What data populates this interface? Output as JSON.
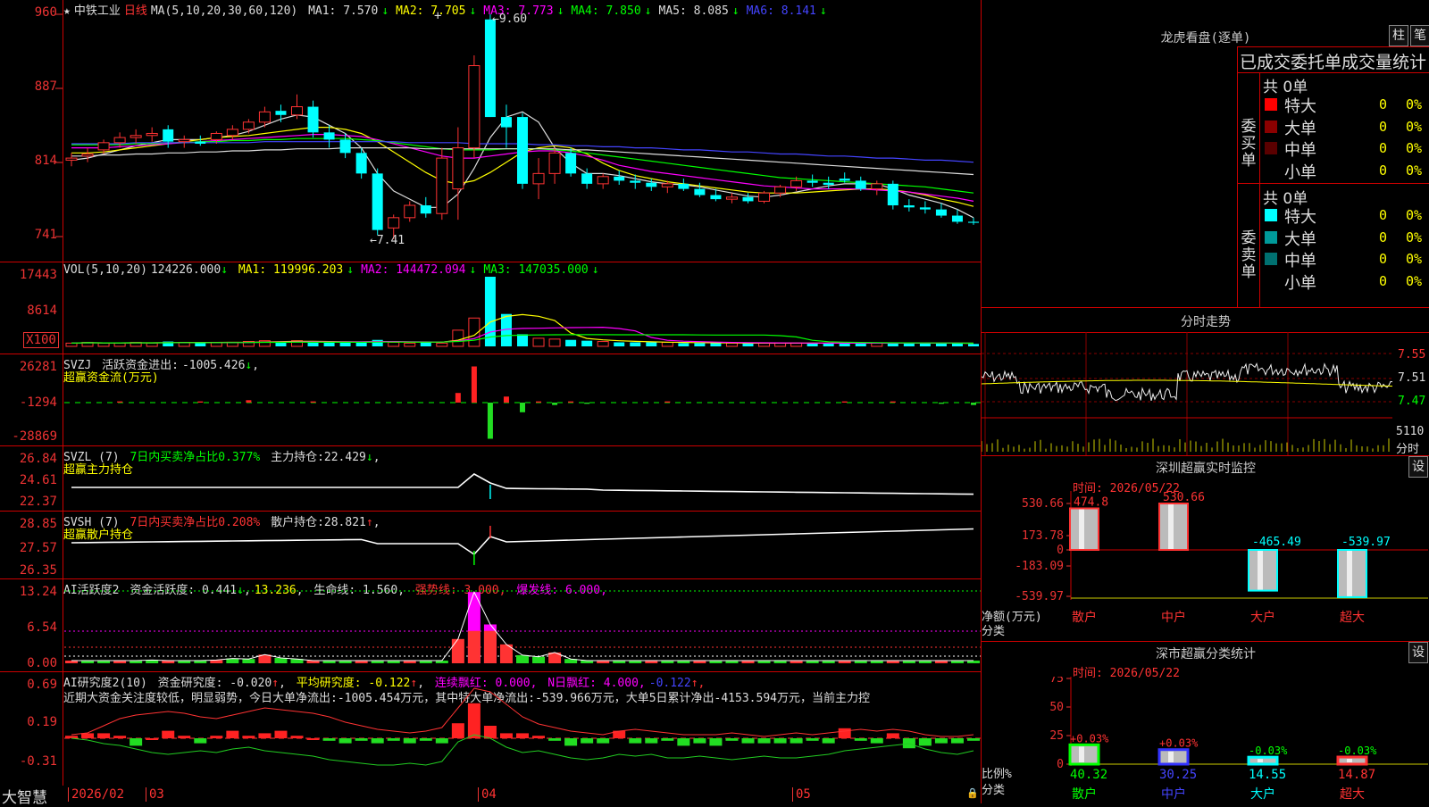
{
  "main": {
    "stock_name": "中铁工业",
    "period": "日线",
    "ma_params": "MA(5,10,20,30,60,120)",
    "ma": [
      {
        "label": "MA1:",
        "value": "7.570",
        "arrow": "↓",
        "color": "#dddddd"
      },
      {
        "label": "MA2:",
        "value": "7.705",
        "arrow": "↓",
        "color": "#ffff00"
      },
      {
        "label": "MA3:",
        "value": "7.773",
        "arrow": "↓",
        "color": "#ff00ff"
      },
      {
        "label": "MA4:",
        "value": "7.850",
        "arrow": "↓",
        "color": "#00ff00"
      },
      {
        "label": "MA5:",
        "value": "8.085",
        "arrow": "↓",
        "color": "#dddddd"
      },
      {
        "label": "MA6:",
        "value": "8.141",
        "arrow": "↓",
        "color": "#4444ff"
      }
    ],
    "y_labels": [
      "960",
      "887",
      "814",
      "741"
    ],
    "high_label": "9.60",
    "low_label": "7.41",
    "candles": [
      [
        8.18,
        8.25,
        8.12,
        8.2
      ],
      [
        8.22,
        8.3,
        8.16,
        8.24
      ],
      [
        8.28,
        8.38,
        8.24,
        8.35
      ],
      [
        8.35,
        8.45,
        8.3,
        8.4
      ],
      [
        8.4,
        8.48,
        8.34,
        8.42
      ],
      [
        8.42,
        8.5,
        8.36,
        8.44
      ],
      [
        8.48,
        8.52,
        8.3,
        8.36
      ],
      [
        8.36,
        8.42,
        8.3,
        8.38
      ],
      [
        8.36,
        8.42,
        8.32,
        8.34
      ],
      [
        8.38,
        8.46,
        8.34,
        8.44
      ],
      [
        8.42,
        8.52,
        8.38,
        8.48
      ],
      [
        8.48,
        8.58,
        8.44,
        8.55
      ],
      [
        8.55,
        8.7,
        8.5,
        8.65
      ],
      [
        8.66,
        8.72,
        8.55,
        8.62
      ],
      [
        8.62,
        8.82,
        8.58,
        8.7
      ],
      [
        8.7,
        8.76,
        8.4,
        8.45
      ],
      [
        8.45,
        8.52,
        8.3,
        8.38
      ],
      [
        8.38,
        8.44,
        8.2,
        8.25
      ],
      [
        8.25,
        8.3,
        8.0,
        8.05
      ],
      [
        8.05,
        8.1,
        7.45,
        7.5
      ],
      [
        7.52,
        7.65,
        7.41,
        7.62
      ],
      [
        7.62,
        7.78,
        7.58,
        7.74
      ],
      [
        7.74,
        7.82,
        7.62,
        7.66
      ],
      [
        7.66,
        8.3,
        7.6,
        8.2
      ],
      [
        7.9,
        8.5,
        7.6,
        8.3
      ],
      [
        8.3,
        9.2,
        8.2,
        9.1
      ],
      [
        9.55,
        9.6,
        8.6,
        8.6
      ],
      [
        8.6,
        8.72,
        8.3,
        8.5
      ],
      [
        8.6,
        8.64,
        7.9,
        7.95
      ],
      [
        7.95,
        8.2,
        7.8,
        8.05
      ],
      [
        8.05,
        8.3,
        7.95,
        8.25
      ],
      [
        8.25,
        8.3,
        8.02,
        8.05
      ],
      [
        8.05,
        8.1,
        7.9,
        7.95
      ],
      [
        7.95,
        8.05,
        7.9,
        8.02
      ],
      [
        8.02,
        8.08,
        7.94,
        7.98
      ],
      [
        7.98,
        8.04,
        7.9,
        7.96
      ],
      [
        7.96,
        8.0,
        7.88,
        7.92
      ],
      [
        7.92,
        7.98,
        7.86,
        7.95
      ],
      [
        7.95,
        8.0,
        7.88,
        7.9
      ],
      [
        7.9,
        7.96,
        7.82,
        7.84
      ],
      [
        7.84,
        7.9,
        7.78,
        7.8
      ],
      [
        7.8,
        7.86,
        7.76,
        7.82
      ],
      [
        7.82,
        7.86,
        7.76,
        7.78
      ],
      [
        7.78,
        7.88,
        7.76,
        7.86
      ],
      [
        7.86,
        7.94,
        7.82,
        7.92
      ],
      [
        7.92,
        8.02,
        7.88,
        7.98
      ],
      [
        7.98,
        8.04,
        7.92,
        7.96
      ],
      [
        7.96,
        8.02,
        7.9,
        7.94
      ],
      [
        8.0,
        8.06,
        7.96,
        7.98
      ],
      [
        7.98,
        8.02,
        7.88,
        7.9
      ],
      [
        7.9,
        7.98,
        7.84,
        7.95
      ],
      [
        7.95,
        7.98,
        7.7,
        7.74
      ],
      [
        7.74,
        7.8,
        7.68,
        7.72
      ],
      [
        7.72,
        7.78,
        7.66,
        7.7
      ],
      [
        7.7,
        7.76,
        7.62,
        7.64
      ],
      [
        7.64,
        7.7,
        7.56,
        7.58
      ],
      [
        7.58,
        7.62,
        7.55,
        7.57
      ]
    ],
    "ma_series": {
      "ma5": [
        8.18,
        8.2,
        8.24,
        8.28,
        8.32,
        8.35,
        8.38,
        8.38,
        8.38,
        8.4,
        8.42,
        8.46,
        8.52,
        8.58,
        8.62,
        8.6,
        8.52,
        8.44,
        8.3,
        8.05,
        7.88,
        7.8,
        7.72,
        7.72,
        7.85,
        8.1,
        8.4,
        8.6,
        8.65,
        8.55,
        8.3,
        8.15,
        8.05,
        8.05,
        8.03,
        8.0,
        7.97,
        7.95,
        7.94,
        7.92,
        7.89,
        7.86,
        7.83,
        7.82,
        7.84,
        7.87,
        7.9,
        7.93,
        7.95,
        7.95,
        7.95,
        7.9,
        7.84,
        7.8,
        7.76,
        7.7,
        7.62
      ],
      "ma10": [
        8.25,
        8.25,
        8.26,
        8.28,
        8.3,
        8.32,
        8.34,
        8.36,
        8.38,
        8.4,
        8.41,
        8.42,
        8.44,
        8.46,
        8.48,
        8.5,
        8.5,
        8.48,
        8.44,
        8.36,
        8.26,
        8.16,
        8.06,
        7.98,
        7.95,
        7.98,
        8.06,
        8.16,
        8.26,
        8.3,
        8.32,
        8.3,
        8.24,
        8.15,
        8.08,
        8.03,
        8.0,
        7.97,
        7.95,
        7.93,
        7.91,
        7.89,
        7.87,
        7.86,
        7.86,
        7.86,
        7.87,
        7.88,
        7.89,
        7.9,
        7.9,
        7.89,
        7.87,
        7.84,
        7.8,
        7.77,
        7.73
      ],
      "ma20": [
        8.3,
        8.3,
        8.3,
        8.31,
        8.32,
        8.33,
        8.34,
        8.35,
        8.36,
        8.37,
        8.38,
        8.39,
        8.4,
        8.41,
        8.42,
        8.43,
        8.43,
        8.42,
        8.41,
        8.38,
        8.34,
        8.3,
        8.26,
        8.22,
        8.2,
        8.2,
        8.22,
        8.24,
        8.26,
        8.27,
        8.27,
        8.25,
        8.22,
        8.18,
        8.13,
        8.1,
        8.07,
        8.05,
        8.03,
        8.01,
        7.99,
        7.97,
        7.95,
        7.93,
        7.92,
        7.91,
        7.9,
        7.9,
        7.9,
        7.9,
        7.89,
        7.88,
        7.87,
        7.85,
        7.83,
        7.81,
        7.78
      ],
      "ma30": [
        8.33,
        8.33,
        8.33,
        8.33,
        8.34,
        8.34,
        8.35,
        8.35,
        8.36,
        8.36,
        8.37,
        8.37,
        8.38,
        8.38,
        8.39,
        8.39,
        8.39,
        8.39,
        8.38,
        8.37,
        8.35,
        8.33,
        8.31,
        8.29,
        8.28,
        8.28,
        8.28,
        8.29,
        8.29,
        8.29,
        8.28,
        8.27,
        8.25,
        8.23,
        8.21,
        8.19,
        8.17,
        8.15,
        8.13,
        8.11,
        8.09,
        8.07,
        8.05,
        8.03,
        8.01,
        8.0,
        7.99,
        7.98,
        7.97,
        7.96,
        7.95,
        7.94,
        7.93,
        7.92,
        7.9,
        7.88,
        7.86
      ],
      "ma60": [
        8.22,
        8.22,
        8.23,
        8.23,
        8.24,
        8.24,
        8.25,
        8.25,
        8.26,
        8.26,
        8.27,
        8.27,
        8.28,
        8.28,
        8.29,
        8.29,
        8.29,
        8.3,
        8.3,
        8.3,
        8.3,
        8.3,
        8.29,
        8.29,
        8.29,
        8.29,
        8.29,
        8.29,
        8.29,
        8.29,
        8.29,
        8.28,
        8.28,
        8.27,
        8.26,
        8.25,
        8.24,
        8.23,
        8.22,
        8.21,
        8.2,
        8.19,
        8.18,
        8.17,
        8.16,
        8.15,
        8.14,
        8.13,
        8.12,
        8.11,
        8.1,
        8.09,
        8.08,
        8.07,
        8.06,
        8.05,
        8.04
      ],
      "ma120": [
        8.34,
        8.34,
        8.34,
        8.34,
        8.35,
        8.35,
        8.35,
        8.35,
        8.35,
        8.35,
        8.35,
        8.35,
        8.36,
        8.36,
        8.36,
        8.36,
        8.36,
        8.36,
        8.36,
        8.36,
        8.36,
        8.35,
        8.35,
        8.35,
        8.35,
        8.34,
        8.34,
        8.34,
        8.34,
        8.33,
        8.33,
        8.32,
        8.32,
        8.31,
        8.31,
        8.3,
        8.3,
        8.29,
        8.28,
        8.28,
        8.27,
        8.26,
        8.26,
        8.25,
        8.24,
        8.24,
        8.23,
        8.22,
        8.22,
        8.21,
        8.2,
        8.2,
        8.19,
        8.18,
        8.18,
        8.17,
        8.16
      ]
    }
  },
  "vol": {
    "title": "VOL(5,10,20)",
    "value": "124226.000",
    "arrow": "↓",
    "ma": [
      {
        "label": "MA1:",
        "value": "119996.203",
        "arrow": "↓",
        "color": "#ffff00"
      },
      {
        "label": "MA2:",
        "value": "144472.094",
        "arrow": "↓",
        "color": "#ff00ff"
      },
      {
        "label": "MA3:",
        "value": "147035.000",
        "arrow": "↓",
        "color": "#00ff00"
      }
    ],
    "y_labels": [
      "17443",
      "8614"
    ],
    "unit_label": "X100",
    "bars": [
      4,
      5,
      4,
      4,
      5,
      4,
      6,
      5,
      4,
      5,
      5,
      6,
      7,
      6,
      7,
      5,
      5,
      5,
      5,
      8,
      5,
      4,
      5,
      4,
      20,
      35,
      86,
      40,
      15,
      10,
      9,
      8,
      7,
      6,
      5,
      5,
      5,
      5,
      4,
      4,
      4,
      4,
      4,
      4,
      4,
      4,
      4,
      4,
      4,
      4,
      4,
      4,
      4,
      4,
      4,
      4,
      3
    ]
  },
  "svzj": {
    "title": "SVZJ",
    "label1": "活跃资金进出:",
    "value1": "-1005.426",
    "arrow1": "↓",
    "label2": "超赢资金流(万元)",
    "y_labels": [
      "26281",
      "-1294",
      "-28869"
    ],
    "bars": [
      0,
      0,
      0,
      1,
      0,
      0,
      0,
      0,
      1,
      0,
      0,
      2,
      0,
      0,
      0,
      1,
      0,
      0,
      0,
      0,
      0,
      0,
      0,
      0,
      8,
      30,
      -30,
      5,
      -8,
      1,
      -2,
      1,
      -1,
      0,
      0,
      0,
      0,
      1,
      0,
      0,
      0,
      0,
      0,
      0,
      0,
      0,
      0,
      0,
      1,
      0,
      0,
      1,
      0,
      0,
      -1,
      0,
      -2
    ]
  },
  "svzl": {
    "title": "SVZL",
    "param": "(7)",
    "label1": "7日内买卖净占比0.377%",
    "label2": "主力持仓:",
    "value2": "22.429",
    "arrow2": "↓",
    "label3": "超赢主力持仓",
    "y_labels": [
      "26.84",
      "24.61",
      "22.37"
    ]
  },
  "svsh": {
    "title": "SVSH",
    "param": "(7)",
    "label1": "7日内买卖净占比0.208%",
    "label2": "散户持仓:",
    "value2": "28.821",
    "arrow2": "↑",
    "label3": "超赢散户持仓",
    "y_labels": [
      "28.85",
      "27.57",
      "26.35"
    ]
  },
  "ai_active": {
    "title": "AI活跃度2",
    "label1": "资金活跃度:",
    "value1": "0.441",
    "arrow1": "↓",
    "value2": "13.236",
    "label3": "生命线:",
    "value3": "1.560",
    "label4": "强势线:",
    "value4": "3.000",
    "label5": "爆发线:",
    "value5": "6.000",
    "y_labels": [
      "13.24",
      "6.54",
      "0.00"
    ]
  },
  "ai_research": {
    "title": "AI研究度2(10)",
    "label1": "资金研究度:",
    "value1": "-0.020",
    "arrow1": "↑",
    "label2": "平均研究度:",
    "value2": "-0.122",
    "arrow2": "↑",
    "label3": "连续飘红:",
    "value3": "0.000",
    "label4": "N日飘红:",
    "value4": "4.000",
    "value5": "-0.122",
    "arrow5": "↑",
    "comment": "近期大资金关注度较低，明显弱势，今日大单净流出:-1005.454万元，其中特大单净流出:-539.966万元，大单5日累计净出-4153.594万元，当前主力控",
    "y_labels": [
      "0.69",
      "0.19",
      "-0.31"
    ]
  },
  "x_axis": {
    "year_month": "2026/02",
    "months": [
      "03",
      "04",
      "05"
    ]
  },
  "brand": "大智慧",
  "right": {
    "dragon_title": "龙虎看盘(逐单)",
    "btn_bar": "柱",
    "btn_single": "笔",
    "stats_title": "已成交委托单成交量统计",
    "buy_section_label": "委买单",
    "sell_section_label": "委卖单",
    "buy_total": "共 0单",
    "sell_total": "共 0单",
    "buy_rows": [
      {
        "label": "特大",
        "count": "0",
        "pct": "0%",
        "color": "#ff0000"
      },
      {
        "label": "大单",
        "count": "0",
        "pct": "0%",
        "color": "#8b0000"
      },
      {
        "label": "中单",
        "count": "0",
        "pct": "0%",
        "color": "#5a0000"
      },
      {
        "label": "小单",
        "count": "0",
        "pct": "0%",
        "color": "#000000"
      }
    ],
    "sell_rows": [
      {
        "label": "特大",
        "count": "0",
        "pct": "0%",
        "color": "#00ffff"
      },
      {
        "label": "大单",
        "count": "0",
        "pct": "0%",
        "color": "#009a9a"
      },
      {
        "label": "中单",
        "count": "0",
        "pct": "0%",
        "color": "#007070"
      },
      {
        "label": "小单",
        "count": "0",
        "pct": "0%",
        "color": "#000000"
      }
    ],
    "intraday_title": "分时走势",
    "intraday_y": [
      "7.55",
      "7.51",
      "7.47"
    ],
    "intraday_vol": "5110",
    "intraday_vol_unit": "分时",
    "monitor_title": "深圳超赢实时监控",
    "monitor_btn": "设",
    "monitor_time": "时间: 2026/05/22",
    "monitor_y": [
      "530.66",
      "173.78",
      "0",
      "-183.09",
      "-539.97"
    ],
    "monitor_axis_label1": "净额(万元)",
    "monitor_axis_label2": "分类",
    "monitor_bars": [
      {
        "label": "散户",
        "value": 474.8,
        "text": "474.8"
      },
      {
        "label": "中户",
        "value": 530.66,
        "text": "530.66"
      },
      {
        "label": "大户",
        "value": -465.49,
        "text": "-465.49"
      },
      {
        "label": "超大",
        "value": -539.97,
        "text": "-539.97"
      }
    ],
    "class_title": "深市超赢分类统计",
    "class_btn": "设",
    "class_time": "时间: 2026/05/22",
    "class_y": [
      "75",
      "50",
      "25",
      "0"
    ],
    "class_axis_label1": "比例%",
    "class_axis_label2": "分类",
    "class_bars": [
      {
        "label": "散户",
        "value": 40.32,
        "text": "40.32",
        "delta": "+0.03%",
        "color": "#00ff00"
      },
      {
        "label": "中户",
        "value": 30.25,
        "text": "30.25",
        "delta": "+0.03%",
        "color": "#3333ff"
      },
      {
        "label": "大户",
        "value": 14.55,
        "text": "14.55",
        "delta": "-0.03%",
        "color": "#00ffff"
      },
      {
        "label": "超大",
        "value": 14.87,
        "text": "14.87",
        "delta": "-0.03%",
        "color": "#ff3333"
      }
    ]
  }
}
